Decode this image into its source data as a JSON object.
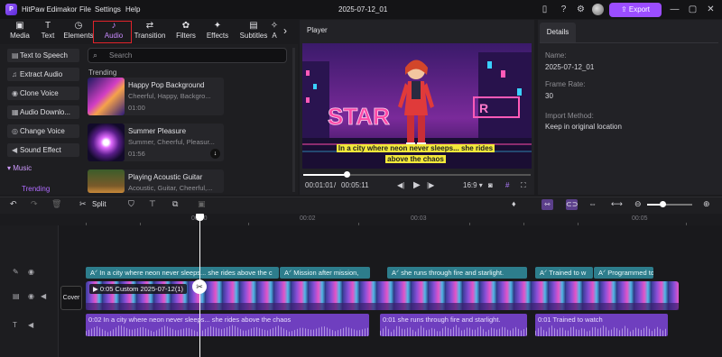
{
  "titlebar": {
    "app_name": "HitPaw Edimakor",
    "menu": [
      "File",
      "Settings",
      "Help"
    ],
    "project_title": "2025-07-12_01",
    "export_label": "Export",
    "logo_text": "P"
  },
  "media_tabs": [
    {
      "label": "Media",
      "icon": "media-icon"
    },
    {
      "label": "Text",
      "icon": "text-icon"
    },
    {
      "label": "Elements",
      "icon": "elements-icon"
    },
    {
      "label": "Audio",
      "icon": "audio-icon",
      "active": true
    },
    {
      "label": "Transition",
      "icon": "transition-icon"
    },
    {
      "label": "Filters",
      "icon": "filters-icon"
    },
    {
      "label": "Effects",
      "icon": "effects-icon"
    },
    {
      "label": "Subtitles",
      "icon": "subtitles-icon"
    },
    {
      "label": "A",
      "icon": "ai-icon"
    }
  ],
  "audio_menu": {
    "items": [
      "Text to Speech",
      "Extract Audio",
      "Clone Voice",
      "Audio Downlo...",
      "Change Voice",
      "Sound Effect"
    ],
    "music_label": "Music",
    "trending_label": "Trending"
  },
  "library": {
    "search_placeholder": "Search",
    "section_title": "Trending",
    "tracks": [
      {
        "title": "Happy Pop Background",
        "tags": "Cheerful, Happy, Backgro...",
        "duration": "01:00"
      },
      {
        "title": "Summer Pleasure",
        "tags": "Summer, Cheerful, Pleasur...",
        "duration": "01:56"
      },
      {
        "title": "Playing Acoustic Guitar",
        "tags": "Acoustic, Guitar, Cheerful,...",
        "duration": ""
      }
    ]
  },
  "player": {
    "title": "Player",
    "caption_line1": "In a city where neon never sleeps... she rides",
    "caption_line2": "above the chaos",
    "current_time": "00:01:01",
    "separator": "/",
    "total_time": "00:05:11",
    "aspect": "16:9",
    "progress": 0.19
  },
  "details": {
    "tab_label": "Details",
    "name_label": "Name:",
    "name_value": "2025-07-12_01",
    "frame_rate_label": "Frame Rate:",
    "frame_rate_value": "30",
    "import_label": "Import Method:",
    "import_value": "Keep in original location"
  },
  "timeline_toolbar": {
    "split_label": "Split",
    "zoom": 0.33
  },
  "ruler": {
    "labels": [
      "00:00",
      "00:02",
      "00:03",
      "00:05"
    ]
  },
  "tracks": {
    "cover_label": "Cover",
    "subtitles": [
      "In a city where neon never sleeps... she rides above the c",
      "Mission after mission,",
      "she runs through fire and starlight.",
      "Trained to w",
      "Programmed to"
    ],
    "video_label": "0:05  Custom  2025-07-12(1)",
    "audio": [
      "0:02  In a city where neon never sleeps... she rides above the chaos",
      "0:01  she runs through fire and starlight.",
      "0:01  Trained to watch"
    ]
  },
  "colors": {
    "accent": "#9b4dff",
    "subtitle_clip": "#2d7d8c",
    "audio_clip": "#6f3fbf",
    "tab_highlight_border": "#e2232a",
    "caption_bg": "#f2e83a"
  }
}
